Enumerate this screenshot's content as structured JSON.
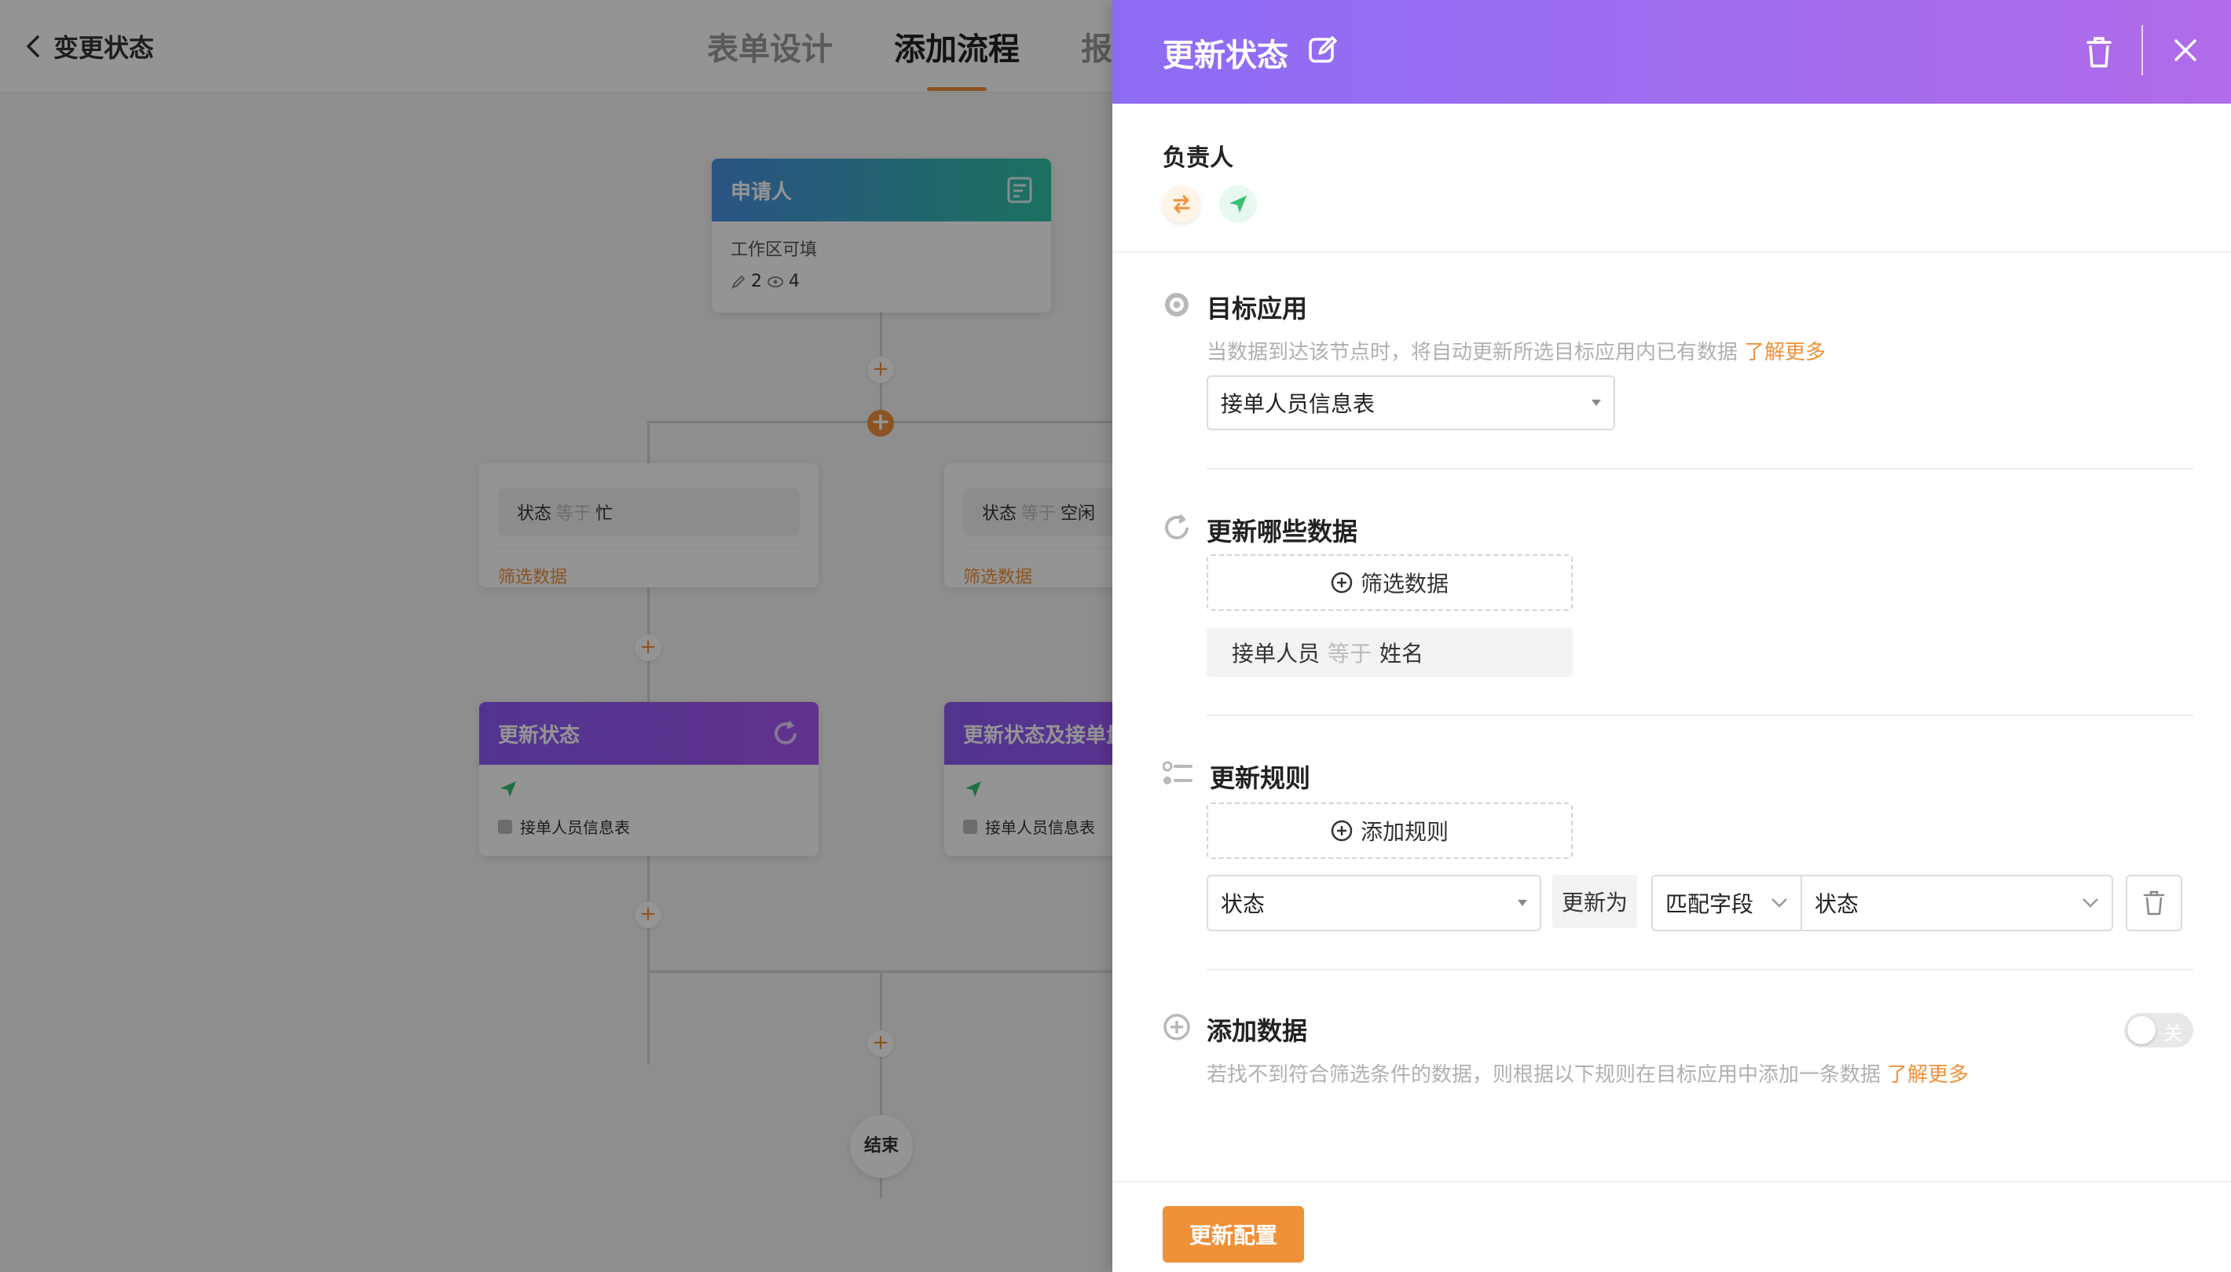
{
  "app": {
    "page_title": "变更状态",
    "tabs": [
      {
        "label": "表单设计",
        "active": false
      },
      {
        "label": "添加流程",
        "active": true
      },
      {
        "label": "报",
        "active": false
      }
    ]
  },
  "flow": {
    "applicant_node": {
      "title": "申请人",
      "desc": "工作区可填",
      "edit_count": "2",
      "view_count": "4"
    },
    "branches": [
      {
        "field": "状态",
        "op": "等于",
        "value": "忙",
        "filter_link": "筛选数据"
      },
      {
        "field": "状态",
        "op": "等于",
        "value": "空闲",
        "filter_link": "筛选数据"
      }
    ],
    "update_nodes": [
      {
        "title": "更新状态",
        "table": "接单人员信息表"
      },
      {
        "title": "更新状态及接单量",
        "table": "接单人员信息表"
      }
    ],
    "end_label": "结束"
  },
  "drawer": {
    "title": "更新状态",
    "owner_label": "负责人",
    "target_app": {
      "title": "目标应用",
      "desc": "当数据到达该节点时，将自动更新所选目标应用内已有数据",
      "learn_more": "了解更多",
      "selected": "接单人员信息表"
    },
    "update_which": {
      "title": "更新哪些数据",
      "filter_button": "筛选数据",
      "filter": {
        "field": "接单人员",
        "op": "等于",
        "value": "姓名"
      }
    },
    "update_rules": {
      "title": "更新规则",
      "add_button": "添加规则",
      "rule": {
        "field": "状态",
        "update_to_label": "更新为",
        "mode": "匹配字段",
        "target_field": "状态"
      }
    },
    "add_data": {
      "title": "添加数据",
      "desc": "若找不到符合筛选条件的数据，则根据以下规则在目标应用中添加一条数据",
      "learn_more": "了解更多",
      "toggle_label": "关",
      "toggle_on": false
    },
    "submit_button": "更新配置"
  },
  "colors": {
    "accent": "#f0913a",
    "header_start": "#8d6cf5",
    "header_end": "#b06be9"
  }
}
